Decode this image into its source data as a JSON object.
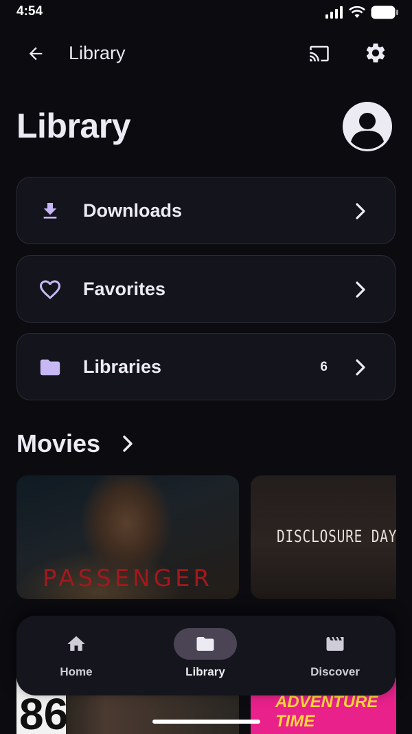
{
  "status_bar": {
    "time": "4:54"
  },
  "app_bar": {
    "title": "Library"
  },
  "header": {
    "title": "Library"
  },
  "menu": [
    {
      "label": "Downloads",
      "icon": "download-icon"
    },
    {
      "label": "Favorites",
      "icon": "heart-icon"
    },
    {
      "label": "Libraries",
      "icon": "folder-icon",
      "count": "6"
    }
  ],
  "section": {
    "title": "Movies"
  },
  "posters": [
    {
      "title": "PASSENGER"
    },
    {
      "title": "DISCLOSURE DAY"
    },
    {
      "title": "86"
    },
    {
      "title": "ADVENTURE TIME"
    }
  ],
  "nav": {
    "items": [
      {
        "label": "Home",
        "icon": "home-icon"
      },
      {
        "label": "Library",
        "icon": "folder-icon",
        "active": true
      },
      {
        "label": "Discover",
        "icon": "clapperboard-icon"
      }
    ]
  },
  "colors": {
    "accent": "#C7B8F5",
    "background": "#0b0b10",
    "card": "#14151c"
  }
}
